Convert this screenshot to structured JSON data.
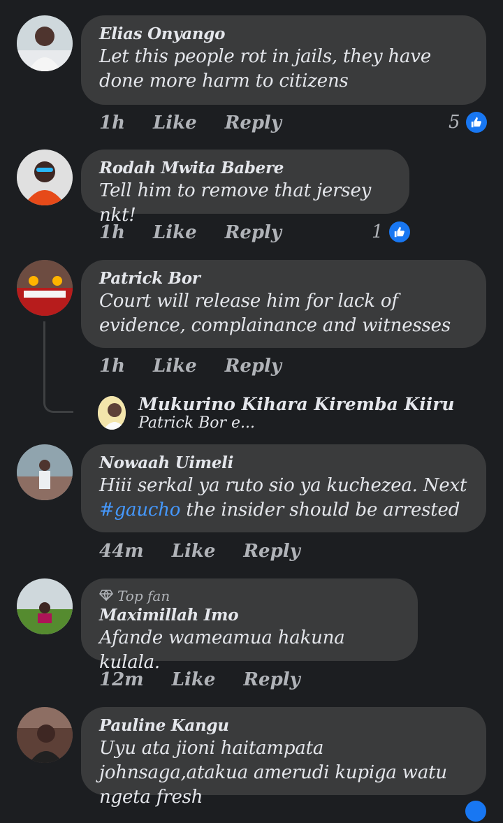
{
  "comments": [
    {
      "author": "Elias Onyango",
      "text": "Let this people rot in jails, they have done more harm to citizens",
      "time": "1h",
      "like": "Like",
      "reply": "Reply",
      "reactions": "5"
    },
    {
      "author": "Rodah Mwita Babere",
      "text": "Tell him to remove that jersey nkt!",
      "time": "1h",
      "like": "Like",
      "reply": "Reply",
      "reactions": "1"
    },
    {
      "author": "Patrick Bor",
      "text": "Court will release him for lack of evidence, complainance and witnesses",
      "time": "1h",
      "like": "Like",
      "reply": "Reply"
    },
    {
      "author": "Nowaah Uimeli",
      "text_before": "Hiii serkal ya ruto sio ya kuchezea. Next",
      "hashtag": "#gaucho",
      "text_after": " the insider  should be arrested",
      "time": "44m",
      "like": "Like",
      "reply": "Reply"
    },
    {
      "badge": "Top fan",
      "author": "Maximillah Imo",
      "text": "Afande wameamua hakuna kulala.",
      "time": "12m",
      "like": "Like",
      "reply": "Reply"
    },
    {
      "author": "Pauline Kangu",
      "text": "Uyu ata jioni haitampata johnsaga,atakua amerudi kupiga watu ngeta fresh"
    }
  ],
  "thread_reply": {
    "author": "Mukurino Kihara Kiremba Kiiru",
    "snippet": "Patrick Bor e..."
  },
  "colors": {
    "background": "#1c1e21",
    "bubble": "#3a3b3c",
    "accent": "#1877f2",
    "hashtag": "#4599ff"
  },
  "icons": {
    "reaction": "like-thumb-icon",
    "badge": "diamond-icon"
  }
}
